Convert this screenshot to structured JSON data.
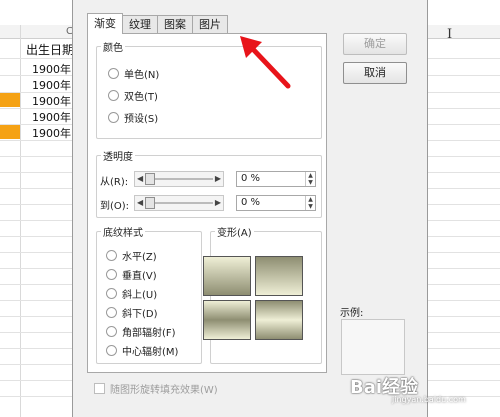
{
  "spreadsheet": {
    "col_header": "C",
    "title_cell": "出生日期",
    "values": [
      "1900年",
      "1900年",
      "1900年",
      "1900年",
      "1900年"
    ],
    "cursor": "I"
  },
  "dialog": {
    "tabs": [
      {
        "label": "渐变",
        "active": true
      },
      {
        "label": "纹理",
        "active": false
      },
      {
        "label": "图案",
        "active": false
      },
      {
        "label": "图片",
        "active": false
      }
    ],
    "color_group": {
      "legend": "颜色",
      "options": [
        "单色(N)",
        "双色(T)",
        "预设(S)"
      ]
    },
    "transparency_group": {
      "legend": "透明度",
      "from_label": "从(R):",
      "from_value": "0 %",
      "to_label": "到(O):",
      "to_value": "0 %"
    },
    "pattern_group": {
      "legend": "底纹样式",
      "options": [
        "水平(Z)",
        "垂直(V)",
        "斜上(U)",
        "斜下(D)",
        "角部辐射(F)",
        "中心辐射(M)"
      ]
    },
    "variants_group": {
      "legend": "变形(A)"
    },
    "buttons": {
      "ok": "确定",
      "cancel": "取消"
    },
    "sample_label": "示例:",
    "rotate_checkbox": "随图形旋转填充效果(W)"
  },
  "colors": {
    "accent_orange": "#f5a215",
    "arrow_red": "#e8141a"
  },
  "watermark": {
    "text": "Bai经验",
    "sub": "jingyan.baidu.com"
  }
}
